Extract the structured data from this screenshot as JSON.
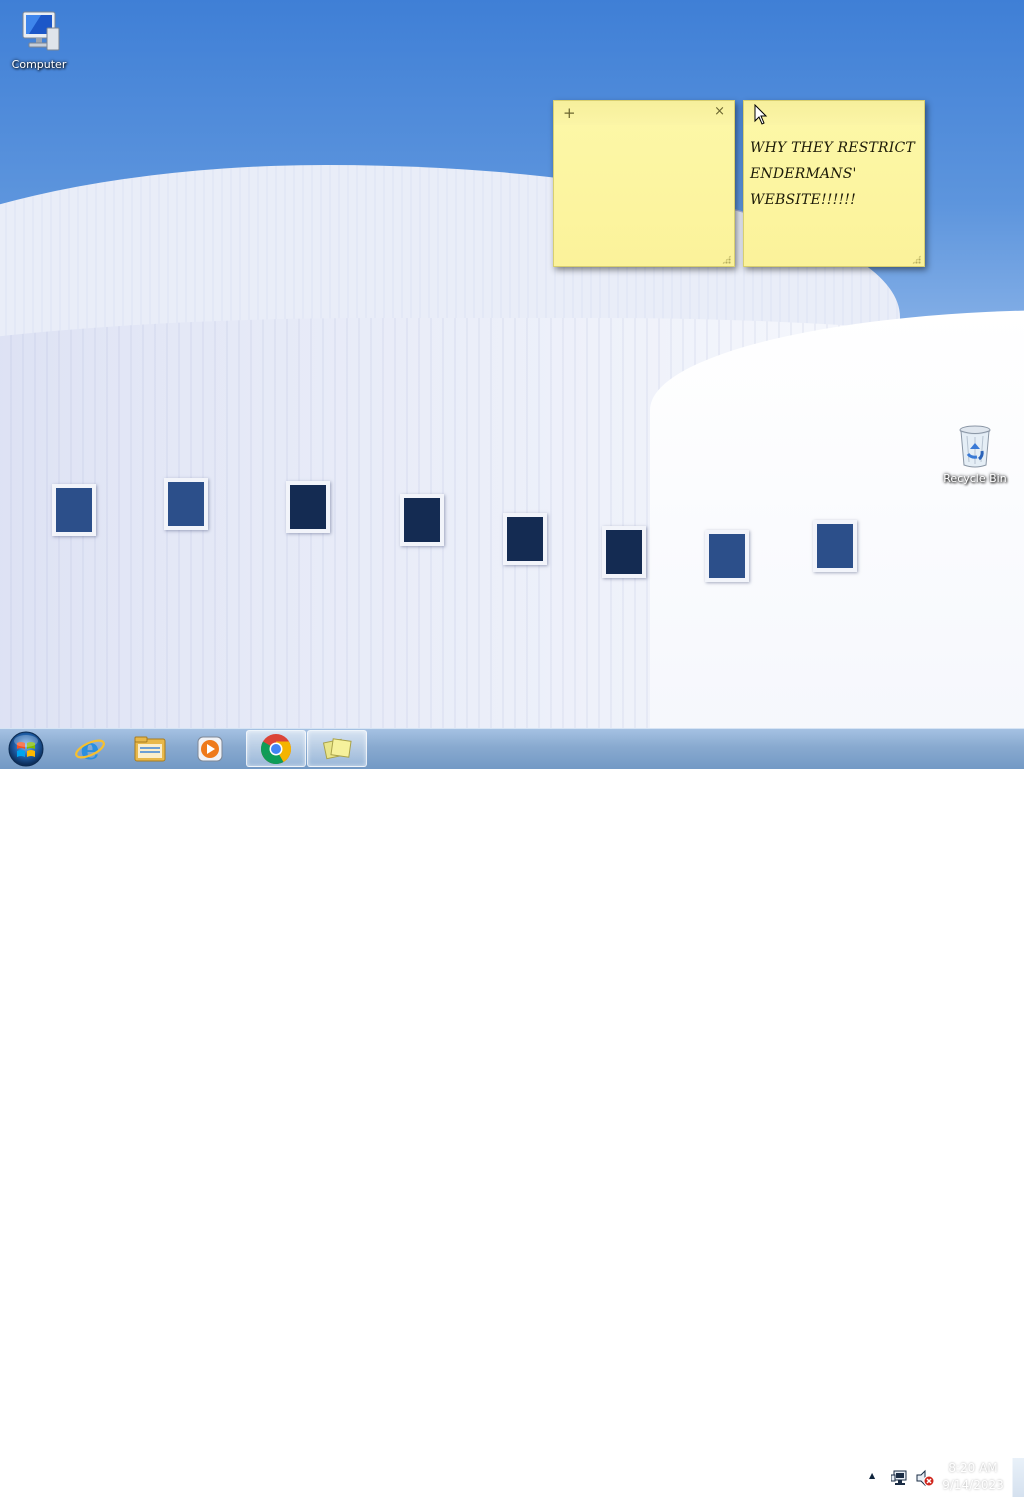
{
  "desktop": {
    "icons": [
      {
        "label": "Computer",
        "icon": "computer-icon"
      },
      {
        "label": "Recycle Bin",
        "icon": "recycle-bin-icon"
      }
    ],
    "wallpaper": "white curved building under blue sky"
  },
  "sticky_notes": [
    {
      "add_label": "+",
      "close_label": "×",
      "lines": []
    },
    {
      "lines": [
        "WHY THEY RESTRICT",
        "ENDERMANS'",
        "WEBSITE!!!!!!"
      ]
    }
  ],
  "taskbar": {
    "start": {
      "icon": "windows-orb-icon"
    },
    "pinned": [
      {
        "name": "Internet Explorer",
        "icon": "internet-explorer-icon",
        "active": false
      },
      {
        "name": "Windows Explorer",
        "icon": "folder-icon",
        "active": false
      },
      {
        "name": "Windows Media Player",
        "icon": "media-player-icon",
        "active": false
      },
      {
        "name": "Google Chrome",
        "icon": "chrome-icon",
        "active": true
      },
      {
        "name": "Sticky Notes",
        "icon": "sticky-notes-icon",
        "active": true
      }
    ],
    "tray": {
      "show_hidden_icon": "▲",
      "network_icon": "network-icon",
      "volume_icon": "volume-muted-icon"
    },
    "clock": {
      "time": "8:20 AM",
      "date": "9/14/2023"
    }
  },
  "colors": {
    "note_yellow": "#fdf8a8",
    "taskbar_blue": "#86a9d0",
    "sky_blue": "#3f7fd6"
  }
}
